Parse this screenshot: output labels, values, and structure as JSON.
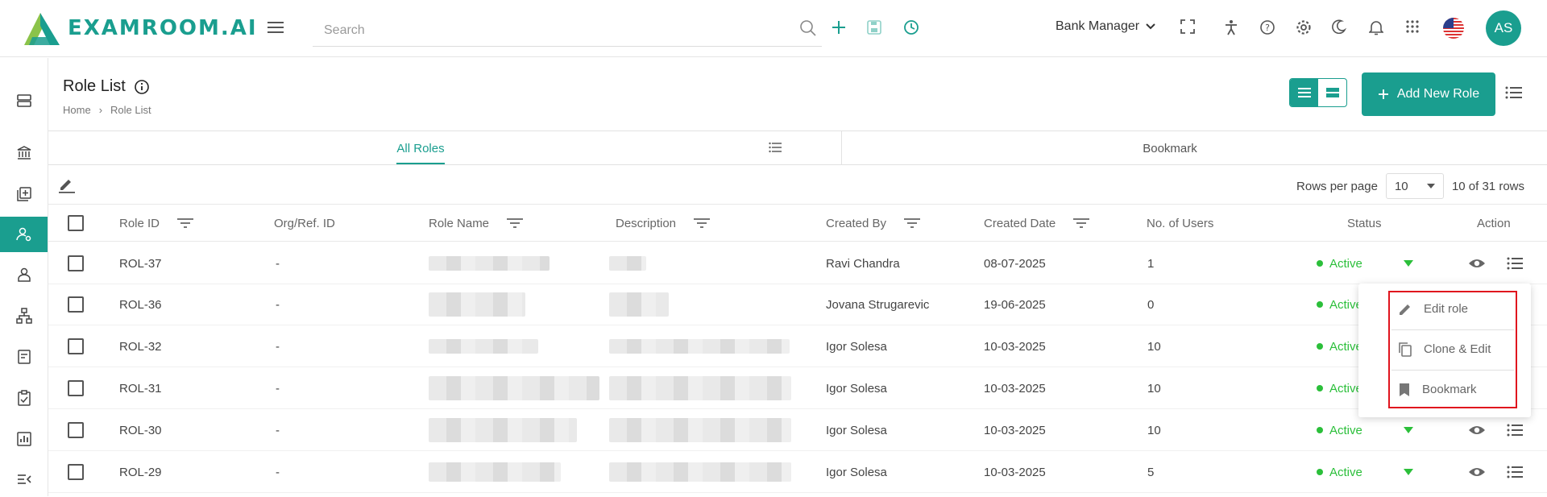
{
  "brand": {
    "name": "EXAMROOM.AI",
    "accent": "#1a9e8f"
  },
  "header": {
    "search_placeholder": "Search",
    "role_selector": "Bank Manager",
    "avatar_initials": "AS"
  },
  "page": {
    "title": "Role List",
    "breadcrumb": [
      "Home",
      "Role List"
    ],
    "add_button": "Add New Role"
  },
  "tabs": [
    {
      "label": "All Roles",
      "active": true
    },
    {
      "label": "Bookmark",
      "active": false
    }
  ],
  "pagination": {
    "rows_per_page_label": "Rows per page",
    "rows_per_page": "10",
    "summary": "10 of 31 rows"
  },
  "table": {
    "columns": [
      "Role ID",
      "Org/Ref. ID",
      "Role Name",
      "Description",
      "Created By",
      "Created Date",
      "No. of Users",
      "Status",
      "Action"
    ],
    "rows": [
      {
        "role_id": "ROL-37",
        "org_ref": "-",
        "created_by": "Ravi Chandra",
        "created_date": "08-07-2025",
        "users": "1",
        "status": "Active"
      },
      {
        "role_id": "ROL-36",
        "org_ref": "-",
        "created_by": "Jovana Strugarevic",
        "created_date": "19-06-2025",
        "users": "0",
        "status": "Active"
      },
      {
        "role_id": "ROL-32",
        "org_ref": "-",
        "created_by": "Igor Solesa",
        "created_date": "10-03-2025",
        "users": "10",
        "status": "Active"
      },
      {
        "role_id": "ROL-31",
        "org_ref": "-",
        "created_by": "Igor Solesa",
        "created_date": "10-03-2025",
        "users": "10",
        "status": "Active"
      },
      {
        "role_id": "ROL-30",
        "org_ref": "-",
        "created_by": "Igor Solesa",
        "created_date": "10-03-2025",
        "users": "10",
        "status": "Active"
      },
      {
        "role_id": "ROL-29",
        "org_ref": "-",
        "created_by": "Igor Solesa",
        "created_date": "10-03-2025",
        "users": "5",
        "status": "Active"
      }
    ]
  },
  "row_menu": {
    "items": [
      "Edit role",
      "Clone & Edit",
      "Bookmark"
    ]
  },
  "colors": {
    "active_status": "#2bbf3a",
    "highlight_border": "#e0141e"
  }
}
